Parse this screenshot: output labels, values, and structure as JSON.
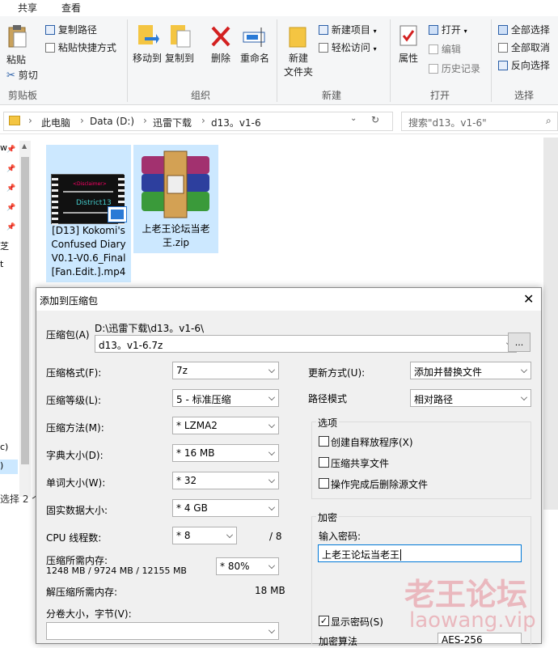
{
  "tabs": {
    "share": "共享",
    "view": "查看"
  },
  "ribbon": {
    "clipboard": {
      "paste": "粘贴",
      "cut": "剪切",
      "copy_path": "复制路径",
      "paste_shortcut": "粘贴快捷方式",
      "group": "剪贴板"
    },
    "organize": {
      "move_to": "移动到",
      "copy_to": "复制到",
      "delete": "删除",
      "rename": "重命名",
      "group": "组织"
    },
    "new": {
      "new_folder": "新建",
      "new_folder2": "文件夹",
      "new_item": "新建项目",
      "easy_access": "轻松访问",
      "group": "新建"
    },
    "open": {
      "properties": "属性",
      "open": "打开",
      "edit": "编辑",
      "history": "历史记录",
      "group": "打开"
    },
    "select": {
      "select_all": "全部选择",
      "select_none": "全部取消",
      "invert": "反向选择",
      "group": "选择"
    }
  },
  "address": {
    "pc": "此电脑",
    "drive": "Data (D:)",
    "folder1": "迅雷下载",
    "folder2": "d13。v1-6",
    "search_placeholder": "搜索\"d13。v1-6\""
  },
  "files": [
    {
      "name": "[D13] Kokomi's Confused Diary V0.1-V0.6_Final [Fan.Edit.].mp4",
      "thumb_title": "<Disclaimer>",
      "thumb_brand": "District13"
    },
    {
      "name": "上老王论坛当老王.zip"
    }
  ],
  "nav": {
    "w_label": "w",
    "bottom1": "c)",
    "bottom2": ")",
    "left1": "芝",
    "left2": "t"
  },
  "status": {
    "selected": "选择 2 个"
  },
  "dialog": {
    "title": "添加到压缩包",
    "archive_label": "压缩包(A)",
    "archive_path": "D:\\迅雷下载\\d13。v1-6\\",
    "archive_name": "d13。v1-6.7z",
    "browse": "...",
    "format_label": "压缩格式(F):",
    "format_value": "7z",
    "level_label": "压缩等级(L):",
    "level_value": "5 - 标准压缩",
    "method_label": "压缩方法(M):",
    "method_value": "* LZMA2",
    "dict_label": "字典大小(D):",
    "dict_value": "* 16 MB",
    "word_label": "单词大小(W):",
    "word_value": "* 32",
    "solid_label": "固实数据大小:",
    "solid_value": "* 4 GB",
    "threads_label": "CPU 线程数:",
    "threads_value": "* 8",
    "threads_total": "/ 8",
    "mem_label": "压缩所需内存:",
    "mem_value": "1248 MB / 9724 MB / 12155 MB",
    "mem_pct": "* 80%",
    "decomp_label": "解压缩所需内存:",
    "decomp_value": "18 MB",
    "split_label": "分卷大小，字节(V):",
    "update_label": "更新方式(U):",
    "update_value": "添加并替换文件",
    "pathmode_label": "路径模式",
    "pathmode_value": "相对路径",
    "options_title": "选项",
    "opt_sfx": "创建自释放程序(X)",
    "opt_shared": "压缩共享文件",
    "opt_delete": "操作完成后删除源文件",
    "enc_title": "加密",
    "enc_pwd_label": "输入密码:",
    "enc_pwd_value": "上老王论坛当老王",
    "show_pwd": "显示密码(S)",
    "enc_method_label": "加密算法",
    "enc_method_value": "AES-256"
  },
  "watermark": {
    "cn": "老王论坛",
    "en": "laowang.vip"
  }
}
